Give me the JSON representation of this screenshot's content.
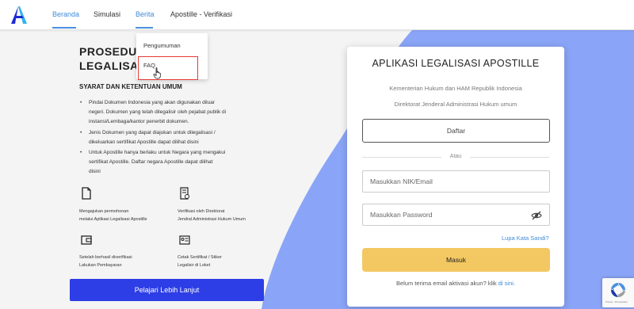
{
  "nav": {
    "items": [
      {
        "label": "Beranda",
        "active": true
      },
      {
        "label": "Simulasi",
        "active": false
      },
      {
        "label": "Berita",
        "active": false
      },
      {
        "label": "Apostille - Verifikasi",
        "active": false
      }
    ]
  },
  "dropdown": {
    "items": [
      "Pengumuman",
      "FAQ"
    ],
    "highlighted": "FAQ"
  },
  "left": {
    "title_line1": "PROSEDUR",
    "title_line2": "LEGALISASI",
    "subtitle": "SYARAT DAN KETENTUAN UMUM",
    "bullets": [
      [
        "Pindai Dokumen Indonesia yang akan digunakan diluar",
        "negeri. Dokumen yang telah dilegalisir oleh pejabat publik di",
        "instansi/Lembaga/kantor penerbit dokumen."
      ],
      [
        "Jenis Dokumen yang dapat diajukan untuk dilegalisasi /",
        "dikeluarkan sertifikat Apostille dapat dilihat disini"
      ],
      [
        "Untuk Apostille hanya berlaku untuk Negara yang mengakui",
        "sertifikat Apostille.  Daftar negara Apostille dapat dilihat",
        "disini"
      ]
    ],
    "features": [
      {
        "icon": "document-icon",
        "lines": [
          "Mengajukan permohonan",
          "melalui Aplikasi Legalisasi Apostille"
        ]
      },
      {
        "icon": "verify-document-icon",
        "lines": [
          "Verifikasi oleh Direktorat",
          "Jendral Administrasi Hukum Umum"
        ]
      },
      {
        "icon": "wallet-icon",
        "lines": [
          "Setelah berhasil diverifikasi",
          "Lakukan Pembayaran"
        ]
      },
      {
        "icon": "id-card-icon",
        "lines": [
          "Cetak Sertifikat / Stiker",
          "Legalisir di Loket"
        ]
      }
    ],
    "learn_more": "Pelajari Lebih Lanjut"
  },
  "card": {
    "title": "APLIKASI LEGALISASI APOSTILLE",
    "sub1": "Kementerian Hukum dan HAM Republik Indonesia",
    "sub2": "Direktorat Jenderal Administrasi Hukum umum",
    "daftar": "Daftar",
    "atau": "Atau",
    "nik_placeholder": "Masukkan NIK/Email",
    "password_placeholder": "Masukkan Password",
    "forgot": "Lupa Kata Sandi?",
    "masuk": "Masuk",
    "activation_text": "Belum terima email aktivasi akun? klik ",
    "activation_link": "di sini."
  },
  "recaptcha": {
    "footer": "Privasi - Persyaratan"
  },
  "colors": {
    "accent_blue": "#3e8bd8",
    "background_blue": "#8aa5f7",
    "learn_button": "#2d3ee6",
    "login_button": "#f3c863",
    "highlight_red": "#e53935"
  }
}
